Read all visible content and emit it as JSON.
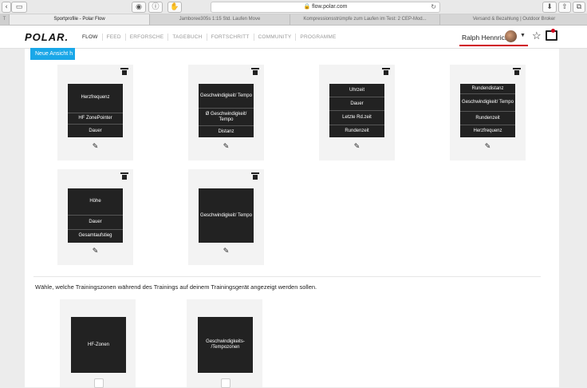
{
  "browser": {
    "url": "flow.polar.com",
    "tabs": [
      {
        "label": "Sportprofile - Polar Flow",
        "active": true
      },
      {
        "label": "Jamboree305s 1:15 Std. Laufen Move",
        "active": false
      },
      {
        "label": "Kompressionsstrümpfe zum Laufen im Test: 2 CEP-Mod...",
        "active": false
      },
      {
        "label": "Versand & Bezahlung | Outdoor Broker",
        "active": false
      }
    ]
  },
  "header": {
    "logo": "POLAR.",
    "nav": [
      "FLOW",
      "FEED",
      "ERFORSCHE",
      "TAGEBUCH",
      "FORTSCHRITT",
      "COMMUNITY",
      "PROGRAMME"
    ],
    "user_name": "Ralph Hennrich"
  },
  "content": {
    "new_view_button": "Neue Ansicht h",
    "views": [
      {
        "rows": [
          "Herzfrequenz",
          "HF ZonePointer",
          "Dauer"
        ]
      },
      {
        "rows": [
          "Geschwindigkeit/ Tempo",
          "Ø Geschwindigkeit/ Tempo",
          "Distanz"
        ]
      },
      {
        "rows": [
          "Uhrzeit",
          "Dauer",
          "Letzte Rd.zeit",
          "Rundenzeit"
        ]
      },
      {
        "rows": [
          "Rundendistanz",
          "Geschwindigkeit/ Tempo",
          "Rundenzeit",
          "Herzfrequenz"
        ]
      },
      {
        "rows": [
          "Höhe",
          "Dauer",
          "Gesamtaufstieg"
        ]
      },
      {
        "rows": [
          "Geschwindigkeit/ Tempo"
        ]
      }
    ],
    "zones_label": "Wähle, welche Trainingszonen während des Trainings auf deinem Trainingsgerät angezeigt werden sollen.",
    "zones": [
      {
        "label": "HF-Zonen"
      },
      {
        "label": "Geschwindigkeits- /Tempozonen"
      }
    ]
  },
  "colors": {
    "accent": "#1aa7e8",
    "brand_red": "#d0021b",
    "screen": "#222222"
  }
}
